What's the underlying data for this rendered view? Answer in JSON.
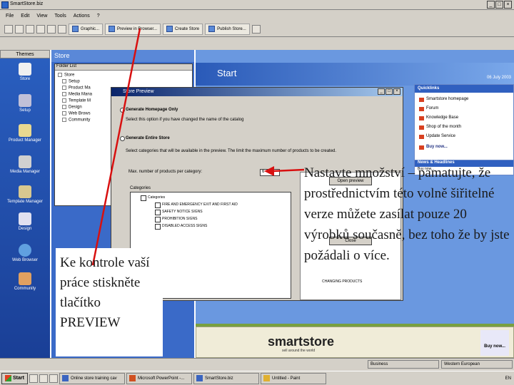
{
  "window": {
    "title": "SmartStore.biz"
  },
  "menu": [
    "File",
    "Edit",
    "View",
    "Tools",
    "Actions",
    "?"
  ],
  "toolbar": {
    "buttons": [
      "Graphic...",
      "Preview in Browser...",
      "Create Store",
      "Publish Store..."
    ]
  },
  "sidebar": {
    "header": "Themes",
    "items": [
      "Store",
      "Setup",
      "Product Manager",
      "Media Manager",
      "Template Manager",
      "Design",
      "Web Browser",
      "Community"
    ]
  },
  "midpane": {
    "title": "Store",
    "folderlist_header": "Folder List",
    "tree": [
      "Store",
      "Setup",
      "Product Ma",
      "Media Mana",
      "Template M",
      "Design",
      "Web Brows",
      "Community"
    ]
  },
  "start": {
    "title": "Start",
    "date": "06 July 2003"
  },
  "quicklinks": {
    "header": "Quicklinks",
    "items": [
      "Smartstore homepage",
      "Forum",
      "Knowledge Base",
      "Shop of the month",
      "Update Service",
      "Buy now..."
    ]
  },
  "news": {
    "header": "News & Headlines",
    "item": "Buy now..."
  },
  "banner": {
    "brand": "smartstore",
    "tagline": "sell around the world",
    "buy": "Buy now..."
  },
  "dialog": {
    "title": "Store Preview",
    "opt1": "Generate Homepage Only",
    "opt1_desc": "Select this option if you have changed the name of the catalog",
    "opt2": "Generate Entire Store",
    "opt2_desc": "Select categories that will be available in the preview. The limit the maximum number of products to be created.",
    "max_label": "Max. number of products per category:",
    "max_value": "6",
    "categories_label": "Categories",
    "categories": [
      "Categories",
      "FIRE AND EMERGENCY EXIT AND FIRST AID",
      "SAFETY NOTICE SIGNS",
      "PROHIBITION SIGNS",
      "DISABLED ACCESS SIGNS"
    ],
    "side_buttons": [
      "Open preview",
      "Close"
    ],
    "side_lines": [
      "CHANGING PRODUCTS"
    ]
  },
  "status": {
    "panes": [
      "Business",
      "Western European"
    ]
  },
  "taskbar": {
    "start": "Start",
    "items": [
      "Online store training cav",
      "Microsoft PowerPoint -...",
      "SmartStore.biz",
      "Untitled - Paint"
    ],
    "time": "EN"
  },
  "annotations": {
    "left": "Ke kontrole vaší práce stiskněte tlačítko PREVIEW",
    "right": "Nastavte množství – pamatujte, že prostřednictvím této volně šiřitelné verze můžete zasílat pouze 20 výrobků současně, bez toho že by jste požádali o více."
  },
  "colors": {
    "accent": "#2a5fc0",
    "arrow": "#d81010"
  }
}
